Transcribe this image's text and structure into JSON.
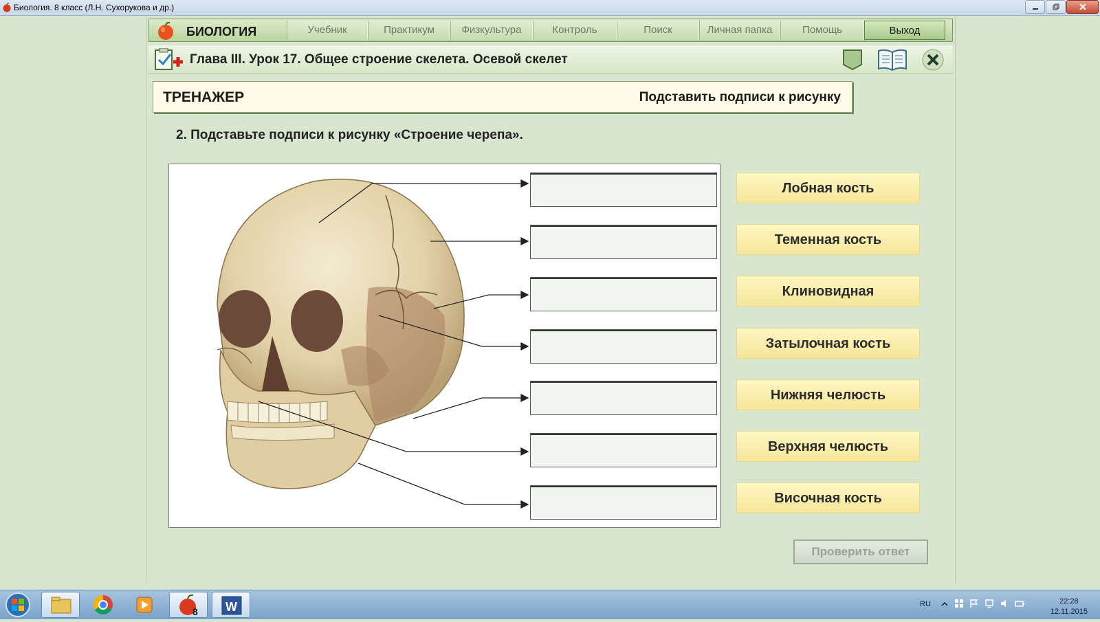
{
  "window": {
    "title": "Биология. 8 класс (Л.Н. Сухорукова и др.)"
  },
  "nav": {
    "brand": "БИОЛОГИЯ",
    "items": [
      "Учебник",
      "Практикум",
      "Физкультура",
      "Контроль",
      "Поиск",
      "Личная папка",
      "Помощь"
    ],
    "exit": "Выход"
  },
  "chapter": {
    "title": "Глава III. Урок 17. Общее строение скелета. Осевой скелет"
  },
  "trainer": {
    "label": "ТРЕНАЖЕР",
    "mode": "Подставить подписи к рисунку"
  },
  "task": {
    "text": "2. Подставьте подписи к рисунку «Строение черепа»."
  },
  "labels": [
    "Лобная кость",
    "Теменная кость",
    "Клиновидная",
    "Затылочная кость",
    "Нижняя челюсть",
    "Верхняя челюсть",
    "Височная кость"
  ],
  "check_button": "Проверить ответ",
  "taskbar": {
    "language": "RU",
    "time": "22:28",
    "date": "12.11.2015"
  },
  "colors": {
    "background": "#d8e6d0",
    "label_button": "#f6e69a",
    "nav_exit": "#a9c98a"
  }
}
